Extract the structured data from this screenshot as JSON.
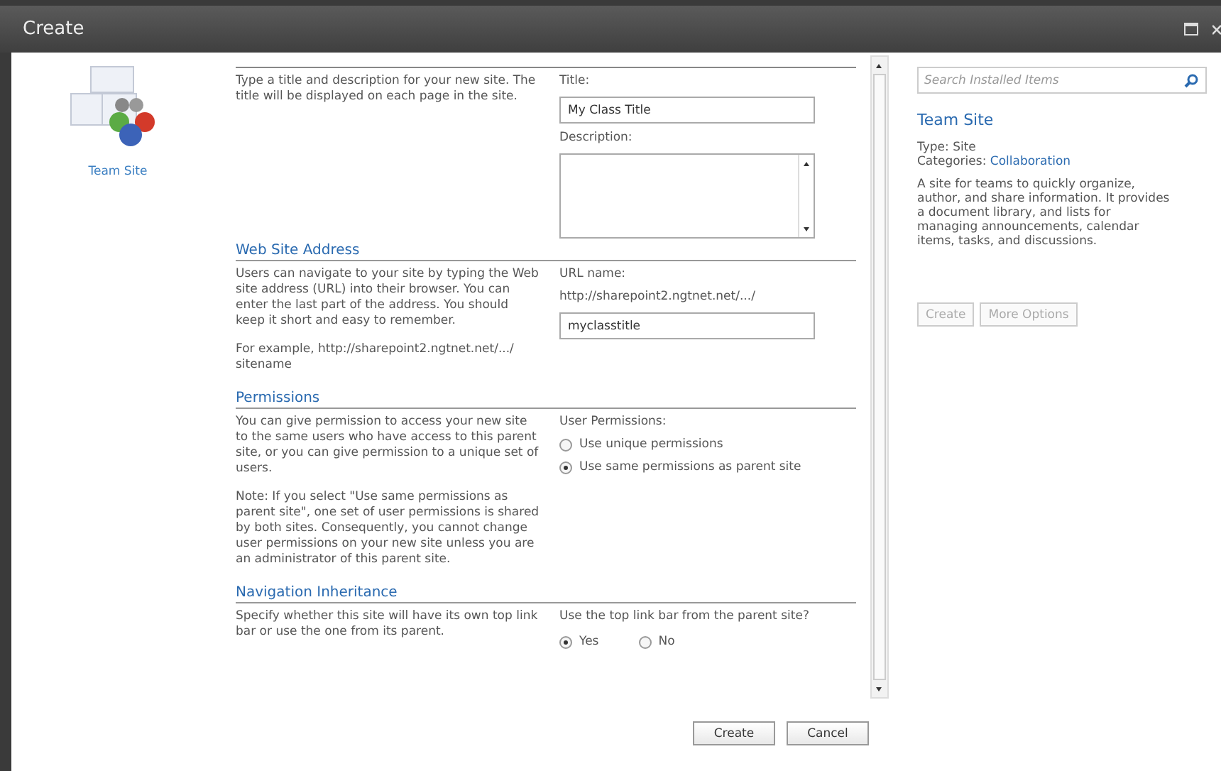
{
  "window": {
    "title": "Create"
  },
  "template": {
    "name": "Team Site"
  },
  "sections": [
    {
      "description": [
        "Type a title and description for your new site. The title will be displayed on each page in the site."
      ],
      "fields": [
        {
          "kind": "text",
          "label": "Title:",
          "value": "My Class Title"
        },
        {
          "kind": "textarea",
          "label": "Description:"
        }
      ]
    },
    {
      "heading": "Web Site Address",
      "description": [
        "Users can navigate to your site by typing the Web site address (URL) into their browser. You can enter the last part of the address. You should keep it short and easy to remember.",
        "For example, http://sharepoint2.ngtnet.net/.../ sitename"
      ],
      "fields": [
        {
          "kind": "label",
          "label": "URL name:"
        },
        {
          "kind": "label",
          "label": "http://sharepoint2.ngtnet.net/.../"
        },
        {
          "kind": "text",
          "value": "myclasstitle"
        }
      ]
    },
    {
      "heading": "Permissions",
      "description": [
        "You can give permission to access your new site to the same users who have access to this parent site, or you can give permission to a unique set of users.",
        "Note: If you select \"Use same permissions as parent site\", one set of user permissions is shared by both sites. Consequently, you cannot change user permissions on your new site unless you are an administrator of this parent site."
      ],
      "fields": [
        {
          "kind": "label",
          "label": "User Permissions:"
        },
        {
          "kind": "radios",
          "options": [
            {
              "label": "Use unique permissions",
              "selected": false
            },
            {
              "label": "Use same permissions as parent site",
              "selected": true
            }
          ]
        }
      ]
    },
    {
      "heading": "Navigation Inheritance",
      "description": [
        "Specify whether this site will have its own top link bar or use the one from its parent."
      ],
      "fields": [
        {
          "kind": "label",
          "label": "Use the top link bar from the parent site?"
        },
        {
          "kind": "radios-inline",
          "options": [
            {
              "label": "Yes",
              "selected": true
            },
            {
              "label": "No",
              "selected": false
            }
          ]
        }
      ]
    }
  ],
  "buttons": [
    "Create",
    "Cancel"
  ],
  "details": {
    "search": {
      "placeholder": "Search Installed Items"
    },
    "title": "Team Site",
    "type": "Type: Site",
    "categories_label": "Categories:",
    "categories": "Collaboration",
    "description": "A site for teams to quickly organize, author, and share information. It provides a document library, and lists for managing announcements, calendar items, tasks, and discussions.",
    "buttons": [
      {
        "label": "Create",
        "disabled": true
      },
      {
        "label": "More Options",
        "disabled": true
      }
    ]
  }
}
